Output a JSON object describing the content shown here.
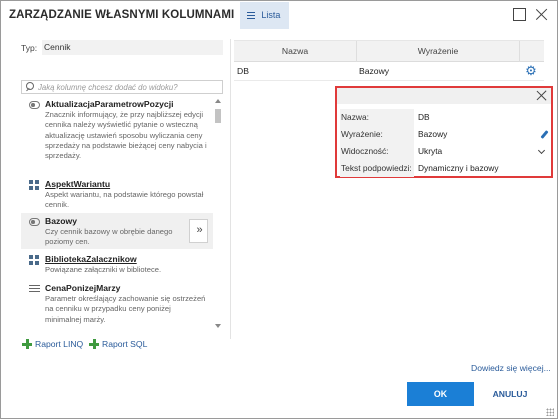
{
  "window": {
    "title": "ZARZĄDZANIE WŁASNYMI KOLUMNAMI",
    "tab_label": "Lista"
  },
  "left": {
    "typ_label": "Typ:",
    "typ_value": "Cennik",
    "search_placeholder": "Jaką kolumnę chcesz dodać do widoku?",
    "items": [
      {
        "name": "AktualizacjaParametrowPozycji",
        "desc": "Znacznik informujący, że przy najbliższej edycji cennika należy wyświetlić pytanie o wsteczną aktualizację ustawień sposobu wyliczania ceny sprzedaży na podstawie bieżącej ceny nabycia i sprzedaży.",
        "icon": "toggle-icon"
      },
      {
        "name": "AspektWariantu",
        "desc": "Aspekt wariantu, na podstawie którego powstał cennik.",
        "icon": "grid-icon"
      },
      {
        "name": "Bazowy",
        "desc": "Czy cennik bazowy w obrębie danego poziomy cen.",
        "icon": "toggle-icon"
      },
      {
        "name": "BibliotekaZalacznikow",
        "desc": "Powiązane załączniki w bibliotece.",
        "icon": "grid-icon"
      },
      {
        "name": "CenaPonizejMarzy",
        "desc": "Parametr określający zachowanie się ostrzeżeń na cenniku w przypadku ceny poniżej minimalnej marży.",
        "icon": "list-icon"
      }
    ],
    "add_button": "»",
    "raport_linq": "Raport LINQ",
    "raport_sql": "Raport SQL"
  },
  "table": {
    "headers": {
      "nazwa": "Nazwa",
      "wyrazenie": "Wyrażenie"
    },
    "row": {
      "nazwa": "DB",
      "wyrazenie": "Bazowy"
    }
  },
  "detail": {
    "nazwa_label": "Nazwa:",
    "nazwa_value": "DB",
    "wyrazenie_label": "Wyrażenie:",
    "wyrazenie_value": "Bazowy",
    "widocznosc_label": "Widoczność:",
    "widocznosc_value": "Ukryta",
    "tekst_label": "Tekst podpowiedzi:",
    "tekst_value": "Dynamiczny i bazowy"
  },
  "footer": {
    "link": "Dowiedz się więcej...",
    "ok": "OK",
    "cancel": "ANULUJ"
  },
  "colors": {
    "accent": "#1b7fd6",
    "link": "#2a5b9a",
    "highlight_border": "#e03a3a",
    "plus": "#3f9a3f"
  }
}
